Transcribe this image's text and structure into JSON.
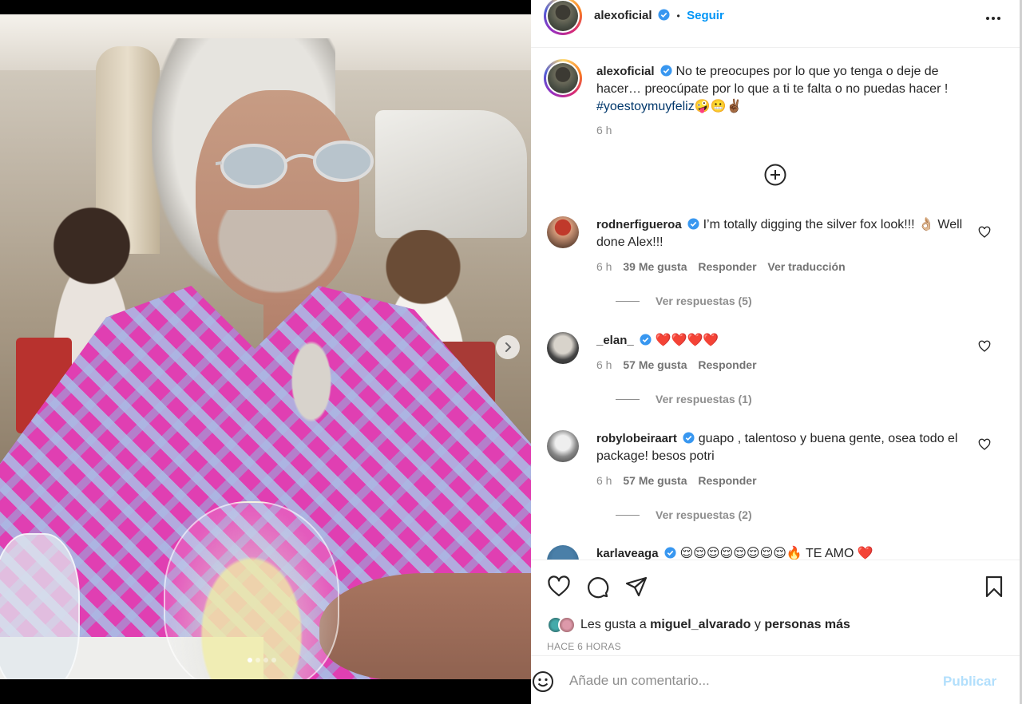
{
  "post": {
    "author": "alexoficial",
    "follow_label": "Seguir",
    "separator": "•",
    "caption_text": "No te preocupes por lo que yo tenga o deje de hacer… preocúpate por lo que a ti te falta o no puedas hacer !",
    "caption_hashtag": "#yoestoymuyfeliz",
    "caption_emoji": "🤪😬✌🏾",
    "caption_time": "6 h",
    "carousel": {
      "current": 1,
      "total": 4
    }
  },
  "comments": [
    {
      "user": "rodnerfigueroa",
      "verified": true,
      "text": "I’m totally digging the silver fox look!!! 👌🏼 Well done Alex!!!",
      "time": "6 h",
      "likes": "39 Me gusta",
      "reply": "Responder",
      "translate": "Ver traducción",
      "replies": "Ver respuestas (5)"
    },
    {
      "user": "_elan_",
      "verified": true,
      "text": "❤️❤️❤️❤️",
      "time": "6 h",
      "likes": "57 Me gusta",
      "reply": "Responder",
      "replies": "Ver respuestas (1)"
    },
    {
      "user": "robylobeiraart",
      "verified": true,
      "text": "guapo , talentoso y buena gente, osea todo el package! besos potri",
      "time": "6 h",
      "likes": "57 Me gusta",
      "reply": "Responder",
      "replies": "Ver respuestas (2)"
    },
    {
      "user": "karlaveaga",
      "verified": true,
      "text": "😌😌😌😌😌😌😌😌🔥 TE AMO ❤️"
    }
  ],
  "likes_line": {
    "prefix": "Les gusta a ",
    "user": "miguel_alvarado",
    "middle": " y ",
    "rest": "personas más"
  },
  "time_ago": "HACE 6 HORAS",
  "comment_box": {
    "placeholder": "Añade un comentario...",
    "publish": "Publicar"
  },
  "colors": {
    "accent": "#0095f6",
    "hashtag": "#00376b",
    "publish_disabled": "#b2dffc",
    "verified": "#3897f0"
  },
  "icons": [
    "chevron-right-icon",
    "more-icon",
    "verified-icon",
    "add-circle-icon",
    "heart-icon",
    "comment-icon",
    "share-icon",
    "bookmark-icon",
    "emoji-icon"
  ]
}
